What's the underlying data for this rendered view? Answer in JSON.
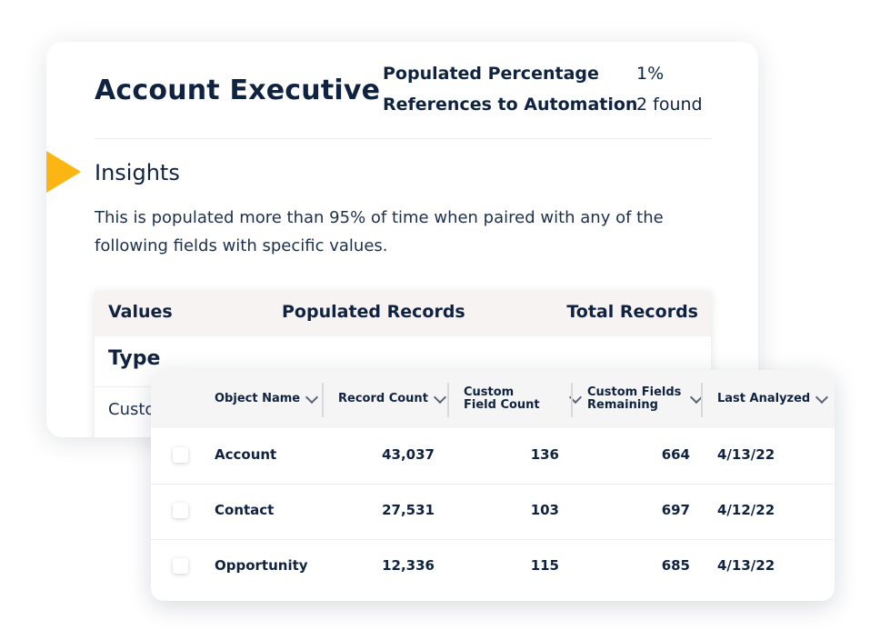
{
  "back_card": {
    "title": "Account Executive",
    "stats": {
      "populated_percentage_label": "Populated Percentage",
      "populated_percentage_value": "1%",
      "references_label": "References to Automation",
      "references_value": "2 found"
    },
    "insights": {
      "heading": "Insights",
      "text": "This is populated more than 95% of time when paired with any of the following fields with specific values."
    },
    "values_table": {
      "headers": [
        "Values",
        "Populated Records",
        "Total Records"
      ],
      "group_label": "Type",
      "first_cell_partial": "Custo"
    }
  },
  "pointer_color": "#fbb614",
  "objects_table": {
    "headers": [
      "Object Name",
      "Record Count",
      "Custom\nField Count",
      "Custom Fields\nRemaining",
      "Last Analyzed"
    ],
    "rows": [
      {
        "name": "Account",
        "record_count": "43,037",
        "custom_field_count": "136",
        "remaining": "664",
        "last_analyzed": "4/13/22"
      },
      {
        "name": "Contact",
        "record_count": "27,531",
        "custom_field_count": "103",
        "remaining": "697",
        "last_analyzed": "4/12/22"
      },
      {
        "name": "Opportunity",
        "record_count": "12,336",
        "custom_field_count": "115",
        "remaining": "685",
        "last_analyzed": "4/13/22"
      }
    ]
  }
}
